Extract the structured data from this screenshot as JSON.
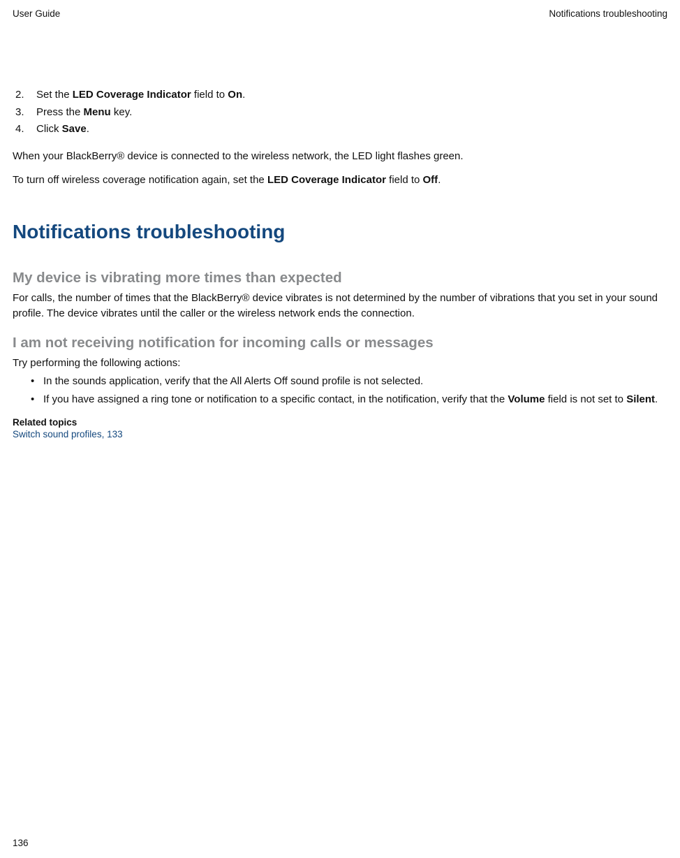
{
  "header": {
    "left": "User Guide",
    "right": "Notifications troubleshooting"
  },
  "steps": [
    {
      "num": "2.",
      "pre": "Set the ",
      "bold1": "LED Coverage Indicator",
      "mid": " field to ",
      "bold2": "On",
      "post": "."
    },
    {
      "num": "3.",
      "pre": "Press the ",
      "bold1": "Menu",
      "mid": " key.",
      "bold2": "",
      "post": ""
    },
    {
      "num": "4.",
      "pre": "Click ",
      "bold1": "Save",
      "mid": ".",
      "bold2": "",
      "post": ""
    }
  ],
  "para1": "When your BlackBerry® device is connected to the wireless network, the LED light flashes green.",
  "para2": {
    "pre": "To turn off wireless coverage notification again, set the ",
    "bold1": "LED Coverage Indicator",
    "mid": " field to ",
    "bold2": "Off",
    "post": "."
  },
  "h1": "Notifications troubleshooting",
  "section1": {
    "h2": "My device is vibrating more times than expected",
    "body": "For calls, the number of times that the BlackBerry® device vibrates is not determined by the number of vibrations that you set in your sound profile. The device vibrates until the caller or the wireless network ends the connection."
  },
  "section2": {
    "h2": "I am not receiving notification for incoming calls or messages",
    "intro": "Try performing the following actions:",
    "bullets": [
      {
        "plain": "In the sounds application, verify that the All Alerts Off sound profile is not selected."
      },
      {
        "pre": "If you have assigned a ring tone or notification to a specific contact, in the notification, verify that the ",
        "bold1": "Volume",
        "mid": " field is not set to ",
        "bold2": "Silent",
        "post": "."
      }
    ]
  },
  "related": {
    "heading": "Related topics",
    "link": "Switch sound profiles, 133"
  },
  "pageNumber": "136"
}
